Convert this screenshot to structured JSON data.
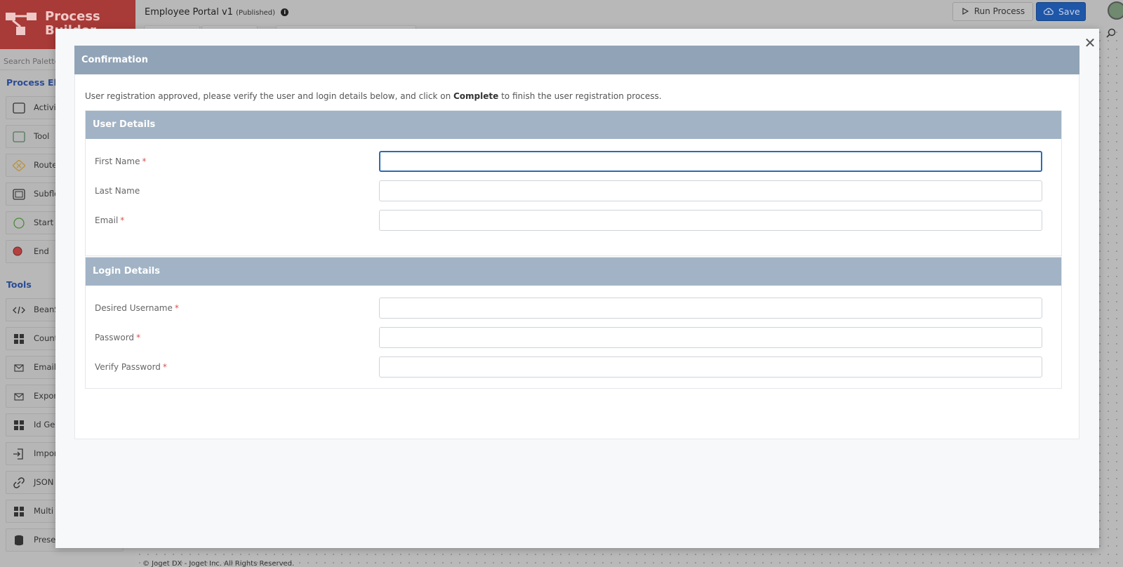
{
  "app": {
    "logo_text": "Process Builder",
    "title": "Employee Portal v1",
    "status": "(Published)",
    "run_label": "Run Process",
    "save_label": "Save",
    "footer": "© Joget DX - Joget Inc. All Rights Reserved."
  },
  "sidebar": {
    "search_placeholder": "Search Palette",
    "process_elements_title": "Process Elements",
    "process_elements": [
      {
        "label": "Activity",
        "icon": "activity-icon"
      },
      {
        "label": "Tool",
        "icon": "tool-icon"
      },
      {
        "label": "Route",
        "icon": "route-icon"
      },
      {
        "label": "Subflow",
        "icon": "subflow-icon"
      },
      {
        "label": "Start",
        "icon": "start-icon"
      },
      {
        "label": "End",
        "icon": "end-icon"
      }
    ],
    "tools_title": "Tools",
    "tools": [
      {
        "label": "BeanShell",
        "icon": "code-icon"
      },
      {
        "label": "Count",
        "icon": "grid-icon"
      },
      {
        "label": "Email",
        "icon": "email-icon"
      },
      {
        "label": "Export",
        "icon": "email-icon"
      },
      {
        "label": "Id Generator",
        "icon": "grid-icon"
      },
      {
        "label": "Import",
        "icon": "import-icon"
      },
      {
        "label": "JSON",
        "icon": "link-icon"
      },
      {
        "label": "Multi Tools",
        "icon": "grid-icon"
      },
      {
        "label": "Preset Form Data",
        "icon": "database-icon"
      }
    ]
  },
  "modal": {
    "header": "Confirmation",
    "intro_before": "User registration approved, please verify the user and login details below, and click on ",
    "intro_bold": "Complete",
    "intro_after": " to finish the user registration process.",
    "user_section": {
      "title": "User Details",
      "fields": [
        {
          "label": "First Name",
          "required": "*",
          "value": ""
        },
        {
          "label": "Last Name",
          "required": "",
          "value": ""
        },
        {
          "label": "Email",
          "required": "*",
          "value": ""
        }
      ]
    },
    "login_section": {
      "title": "Login Details",
      "fields": [
        {
          "label": "Desired Username",
          "required": "*",
          "value": ""
        },
        {
          "label": "Password",
          "required": "*",
          "value": ""
        },
        {
          "label": "Verify Password",
          "required": "*",
          "value": ""
        }
      ]
    }
  },
  "colors": {
    "brand": "#a83a37",
    "header": "#91a3b6",
    "section_header": "#a1b3c5",
    "save": "#1e56a8",
    "required": "#d9534f"
  }
}
